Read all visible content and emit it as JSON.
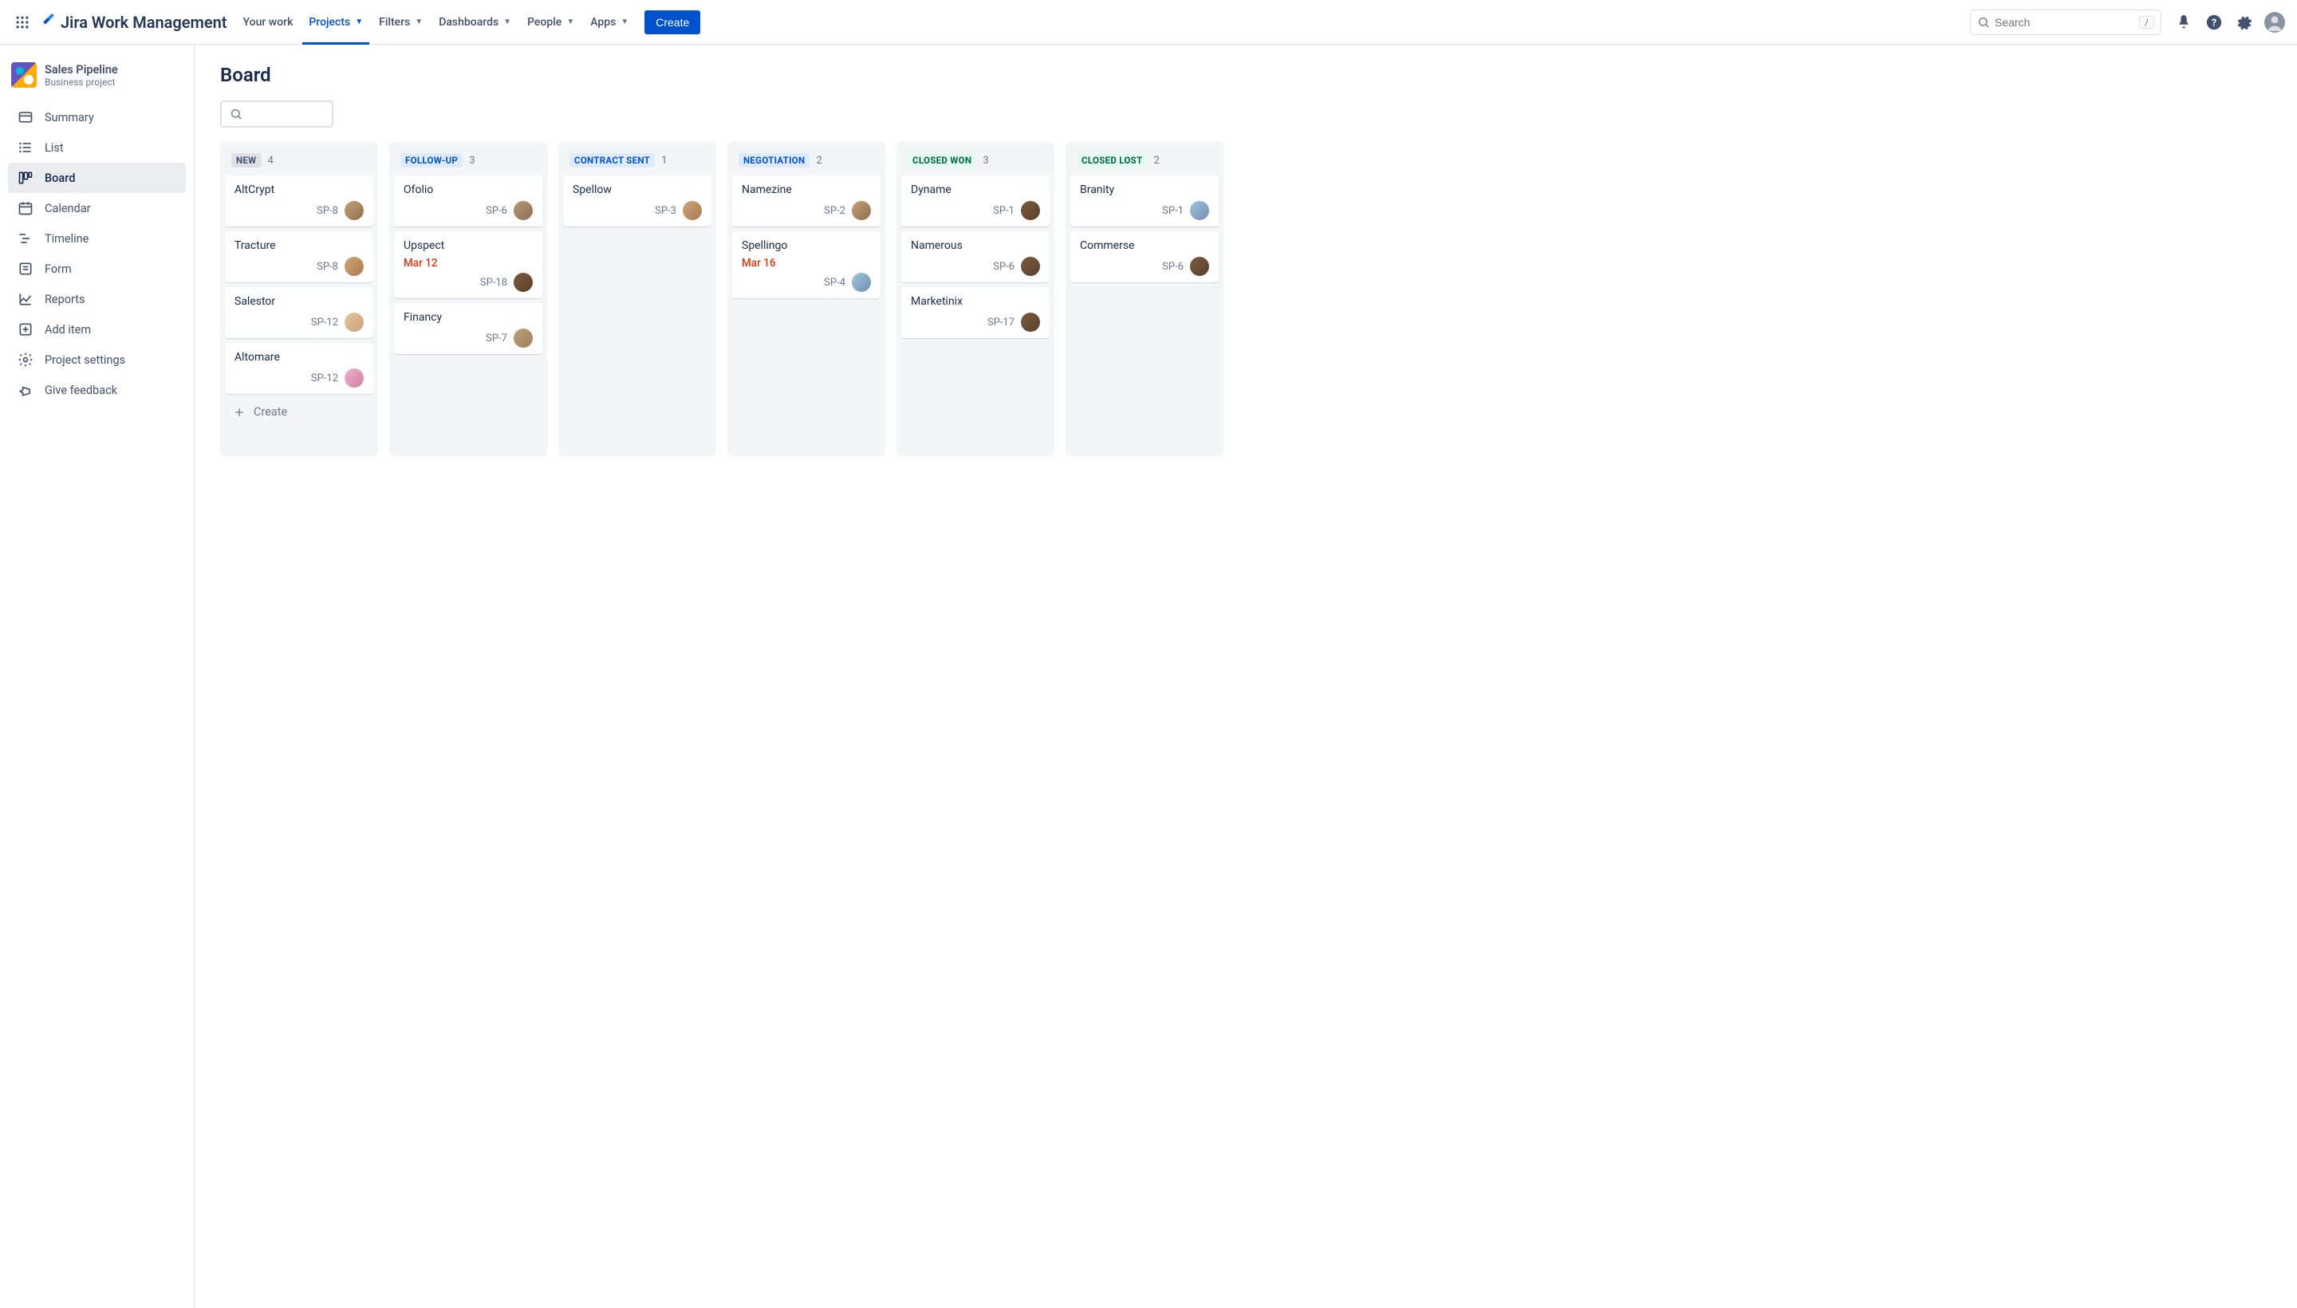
{
  "topnav": {
    "product": "Jira Work Management",
    "items": [
      "Your work",
      "Projects",
      "Filters",
      "Dashboards",
      "People",
      "Apps"
    ],
    "active_index": 1,
    "create": "Create",
    "search_placeholder": "Search",
    "search_key": "/"
  },
  "sidebar": {
    "project_name": "Sales Pipeline",
    "project_type": "Business project",
    "items": [
      {
        "label": "Summary"
      },
      {
        "label": "List"
      },
      {
        "label": "Board"
      },
      {
        "label": "Calendar"
      },
      {
        "label": "Timeline"
      },
      {
        "label": "Form"
      },
      {
        "label": "Reports"
      },
      {
        "label": "Add item"
      },
      {
        "label": "Project settings"
      },
      {
        "label": "Give feedback"
      }
    ],
    "active_index": 2
  },
  "main": {
    "title": "Board",
    "create_card": "Create"
  },
  "columns": [
    {
      "name": "NEW",
      "count": 4,
      "status": "grey",
      "cards": [
        {
          "title": "AltCrypt",
          "key": "SP-8",
          "av": "av1"
        },
        {
          "title": "Tracture",
          "key": "SP-8",
          "av": "av2"
        },
        {
          "title": "Salestor",
          "key": "SP-12",
          "av": "av3"
        },
        {
          "title": "Altomare",
          "key": "SP-12",
          "av": "av5"
        }
      ],
      "show_create": true
    },
    {
      "name": "FOLLOW-UP",
      "count": 3,
      "status": "blue",
      "cards": [
        {
          "title": "Ofolio",
          "key": "SP-6",
          "av": "av4"
        },
        {
          "title": "Upspect",
          "date": "Mar 12",
          "key": "SP-18",
          "av": "av6"
        },
        {
          "title": "Financy",
          "key": "SP-7",
          "av": "av7"
        }
      ]
    },
    {
      "name": "CONTRACT SENT",
      "count": 1,
      "status": "blue",
      "cards": [
        {
          "title": "Spellow",
          "key": "SP-3",
          "av": "av2"
        }
      ]
    },
    {
      "name": "NEGOTIATION",
      "count": 2,
      "status": "blue",
      "cards": [
        {
          "title": "Namezine",
          "key": "SP-2",
          "av": "av1"
        },
        {
          "title": "Spellingo",
          "date": "Mar 16",
          "key": "SP-4",
          "av": "av8"
        }
      ]
    },
    {
      "name": "CLOSED WON",
      "count": 3,
      "status": "green",
      "cards": [
        {
          "title": "Dyname",
          "key": "SP-1",
          "av": "av6"
        },
        {
          "title": "Namerous",
          "key": "SP-6",
          "av": "av6"
        },
        {
          "title": "Marketinix",
          "key": "SP-17",
          "av": "av6"
        }
      ]
    },
    {
      "name": "CLOSED LOST",
      "count": 2,
      "status": "green",
      "cards": [
        {
          "title": "Branity",
          "key": "SP-1",
          "av": "av8"
        },
        {
          "title": "Commerse",
          "key": "SP-6",
          "av": "av6"
        }
      ]
    }
  ]
}
